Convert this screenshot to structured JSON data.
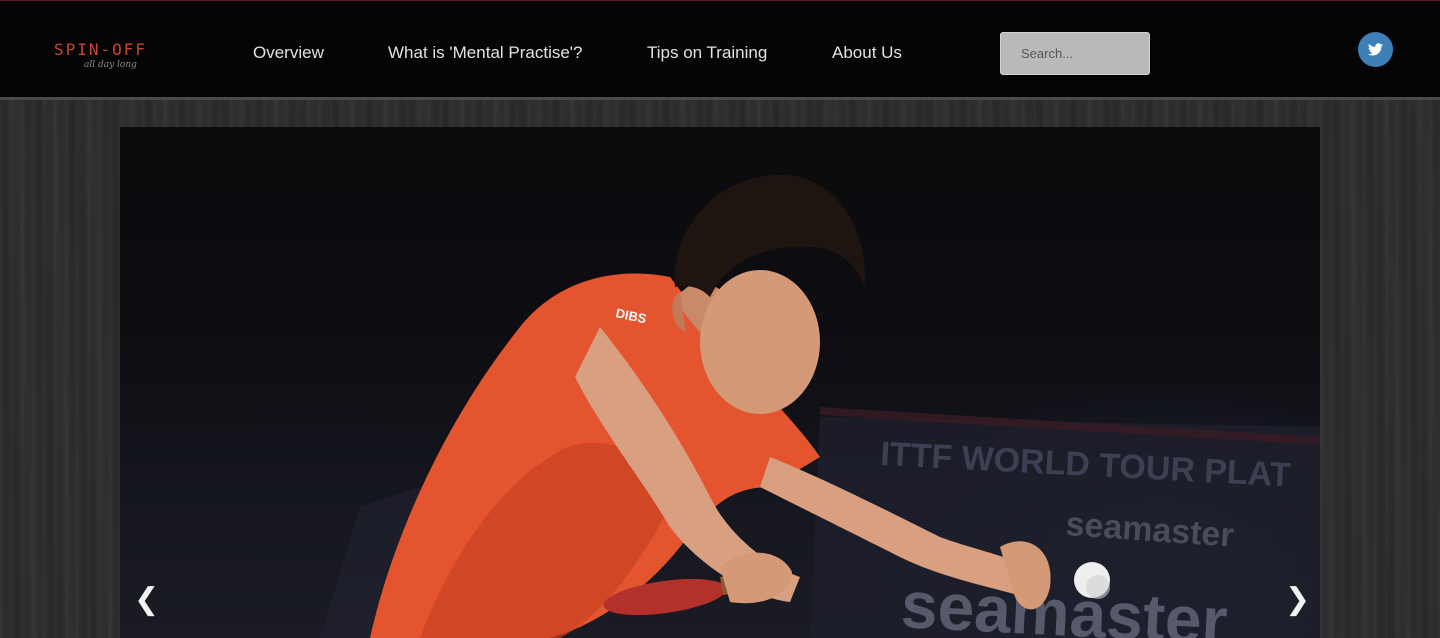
{
  "brand": {
    "name": "SPIN-OFF",
    "tagline": "all day long"
  },
  "nav": {
    "items": [
      {
        "label": "Overview"
      },
      {
        "label": "What is 'Mental Practise'?"
      },
      {
        "label": "Tips on Training"
      },
      {
        "label": "About Us"
      }
    ]
  },
  "search": {
    "placeholder": "Search..."
  },
  "social": {
    "twitter_icon": "twitter-bird-icon"
  },
  "slider": {
    "prev_label": "❮",
    "next_label": "❯",
    "banner_line_1": "ITTF WORLD TOUR PLAT",
    "banner_line_2": "seamaster",
    "banner_line_3": "seamaster",
    "jersey_text": "DIBS"
  },
  "colors": {
    "accent": "#c8462e",
    "header_bg": "#050505",
    "twitter": "#3f7fb8",
    "shirt": "#e85a35"
  }
}
